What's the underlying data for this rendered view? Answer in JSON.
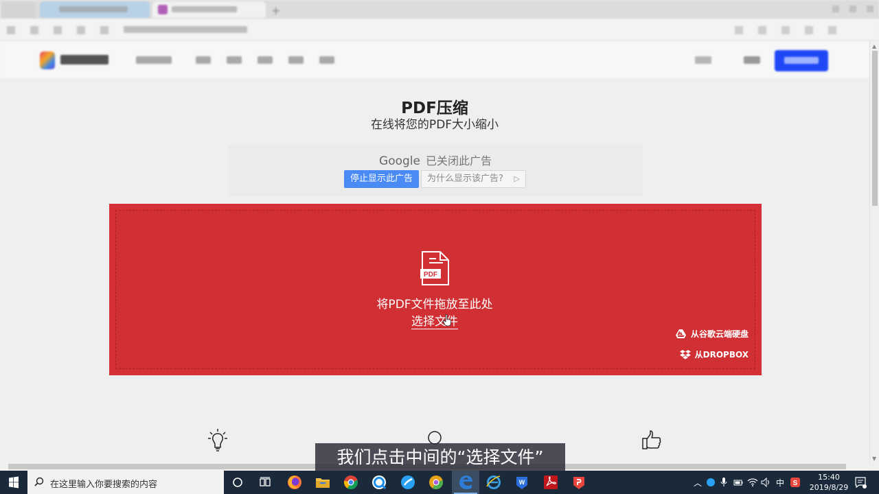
{
  "page": {
    "title": "PDF压缩",
    "subtitle": "在线将您的PDF大小缩小"
  },
  "ad": {
    "google_label": "Google",
    "closed_text": "已关闭此广告",
    "stop_button": "停止显示此广告",
    "why_button": "为什么显示该广告?"
  },
  "dropzone": {
    "drag_text": "将PDF文件拖放至此处",
    "choose_text": "选择文件",
    "pdf_icon_label": "PDF",
    "gdrive_label": "从谷歌云端硬盘",
    "dropbox_label": "从DROPBOX",
    "background_color": "#d43035"
  },
  "caption": {
    "text": "我们点击中间的“选择文件”"
  },
  "taskbar": {
    "search_placeholder": "在这里输入你要搜索的内容",
    "ime_label": "中",
    "time": "15:40",
    "date": "2019/8/29",
    "apps": [
      "firefox-icon",
      "file-explorer-icon",
      "chrome-icon",
      "qq-browser-icon",
      "sogou-icon",
      "chrome-canary-icon",
      "edge-icon",
      "ie-icon",
      "wps-icon",
      "acrobat-icon",
      "wps-pdf-icon"
    ]
  },
  "header": {
    "signup_color": "#1e47f5"
  }
}
